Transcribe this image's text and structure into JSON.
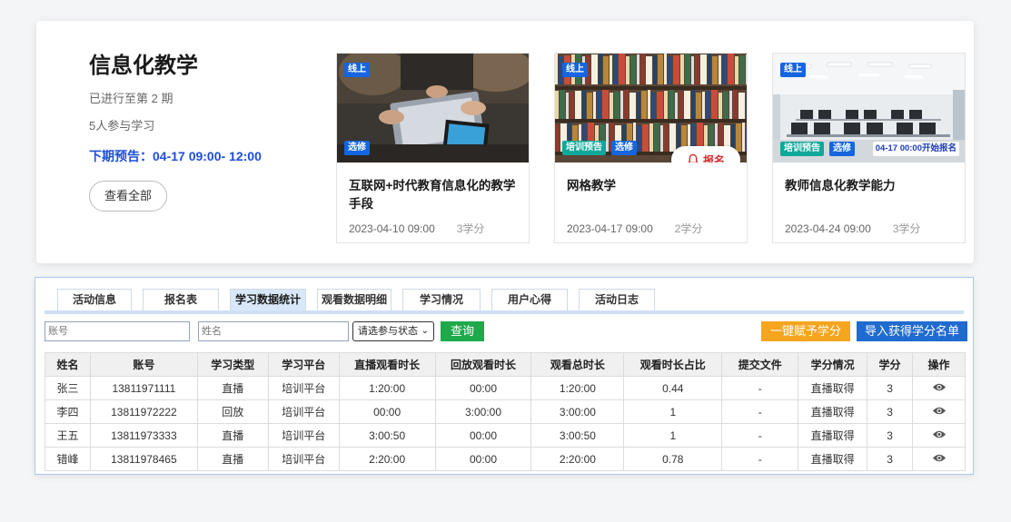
{
  "series": {
    "title": "信息化教学",
    "progress": "已进行至第 2 期",
    "participants": "5人参与学习",
    "next_preview": "下期预告：04-17 09:00- 12:00",
    "view_all": "查看全部"
  },
  "courses": [
    {
      "tag_online": "线上",
      "tag_elective": "选修",
      "name": "互联网+时代教育信息化的教学手段",
      "time": "2023-04-10 09:00",
      "credit": "3学分"
    },
    {
      "tag_online": "线上",
      "tag_preview": "培训预告",
      "tag_elective": "选修",
      "signup": "报名",
      "name": "网格教学",
      "time": "2023-04-17 09:00",
      "credit": "2学分"
    },
    {
      "tag_online": "线上",
      "tag_preview": "培训预告",
      "tag_elective": "选修",
      "enroll_note": "04-17 00:00开始报名",
      "name": "教师信息化教学能力",
      "time": "2023-04-24 09:00",
      "credit": "3学分"
    }
  ],
  "tabs": [
    "活动信息",
    "报名表",
    "学习数据统计",
    "观看数据明细",
    "学习情况",
    "用户心得",
    "活动日志"
  ],
  "active_tab": "学习数据统计",
  "filters": {
    "account_placeholder": "账号",
    "name_placeholder": "姓名",
    "status_select": "请选参与状态",
    "query_button": "查询",
    "grant_button": "一键赋予学分",
    "import_button": "导入获得学分名单"
  },
  "table": {
    "headers": [
      "姓名",
      "账号",
      "学习类型",
      "学习平台",
      "直播观看时长",
      "回放观看时长",
      "观看总时长",
      "观看时长占比",
      "提交文件",
      "学分情况",
      "学分",
      "操作"
    ],
    "rows": [
      [
        "张三",
        "13811971111",
        "直播",
        "培训平台",
        "1:20:00",
        "00:00",
        "1:20:00",
        "0.44",
        "-",
        "直播取得",
        "3"
      ],
      [
        "李四",
        "13811972222",
        "回放",
        "培训平台",
        "00:00",
        "3:00:00",
        "3:00:00",
        "1",
        "-",
        "直播取得",
        "3"
      ],
      [
        "王五",
        "13811973333",
        "直播",
        "培训平台",
        "3:00:50",
        "00:00",
        "3:00:50",
        "1",
        "-",
        "直播取得",
        "3"
      ],
      [
        "错峰",
        "13811978465",
        "直播",
        "培训平台",
        "2:20:00",
        "00:00",
        "2:20:00",
        "0.78",
        "-",
        "直播取得",
        "3"
      ]
    ],
    "action_icon": "eye-icon"
  },
  "colors": {
    "accent_blue": "#1565e0",
    "preview_teal": "#10a89a",
    "query_green": "#1ea94b",
    "grant_orange": "#f5a51e",
    "import_blue": "#1f6bd0",
    "signup_red": "#d32f2f"
  }
}
